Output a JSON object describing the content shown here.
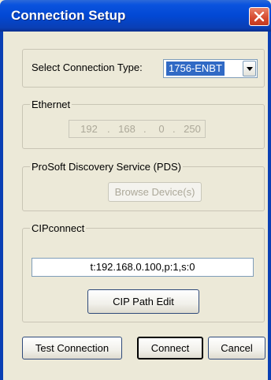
{
  "window": {
    "title": "Connection Setup"
  },
  "connection_type": {
    "label": "Select Connection Type:",
    "selected": "1756-ENBT"
  },
  "ethernet": {
    "legend": "Ethernet",
    "ip": [
      "192",
      "168",
      "0",
      "250"
    ]
  },
  "pds": {
    "legend": "ProSoft Discovery Service (PDS)",
    "browse_label": "Browse Device(s)"
  },
  "cipconnect": {
    "legend": "CIPconnect",
    "path_value": "t:192.168.0.100,p:1,s:0",
    "edit_label": "CIP Path Edit"
  },
  "actions": {
    "test_label": "Test Connection",
    "connect_label": "Connect",
    "cancel_label": "Cancel"
  },
  "colors": {
    "titlebar": "#0248D4",
    "background": "#ECE9D8",
    "selection": "#316AC5",
    "close": "#D5492E"
  }
}
